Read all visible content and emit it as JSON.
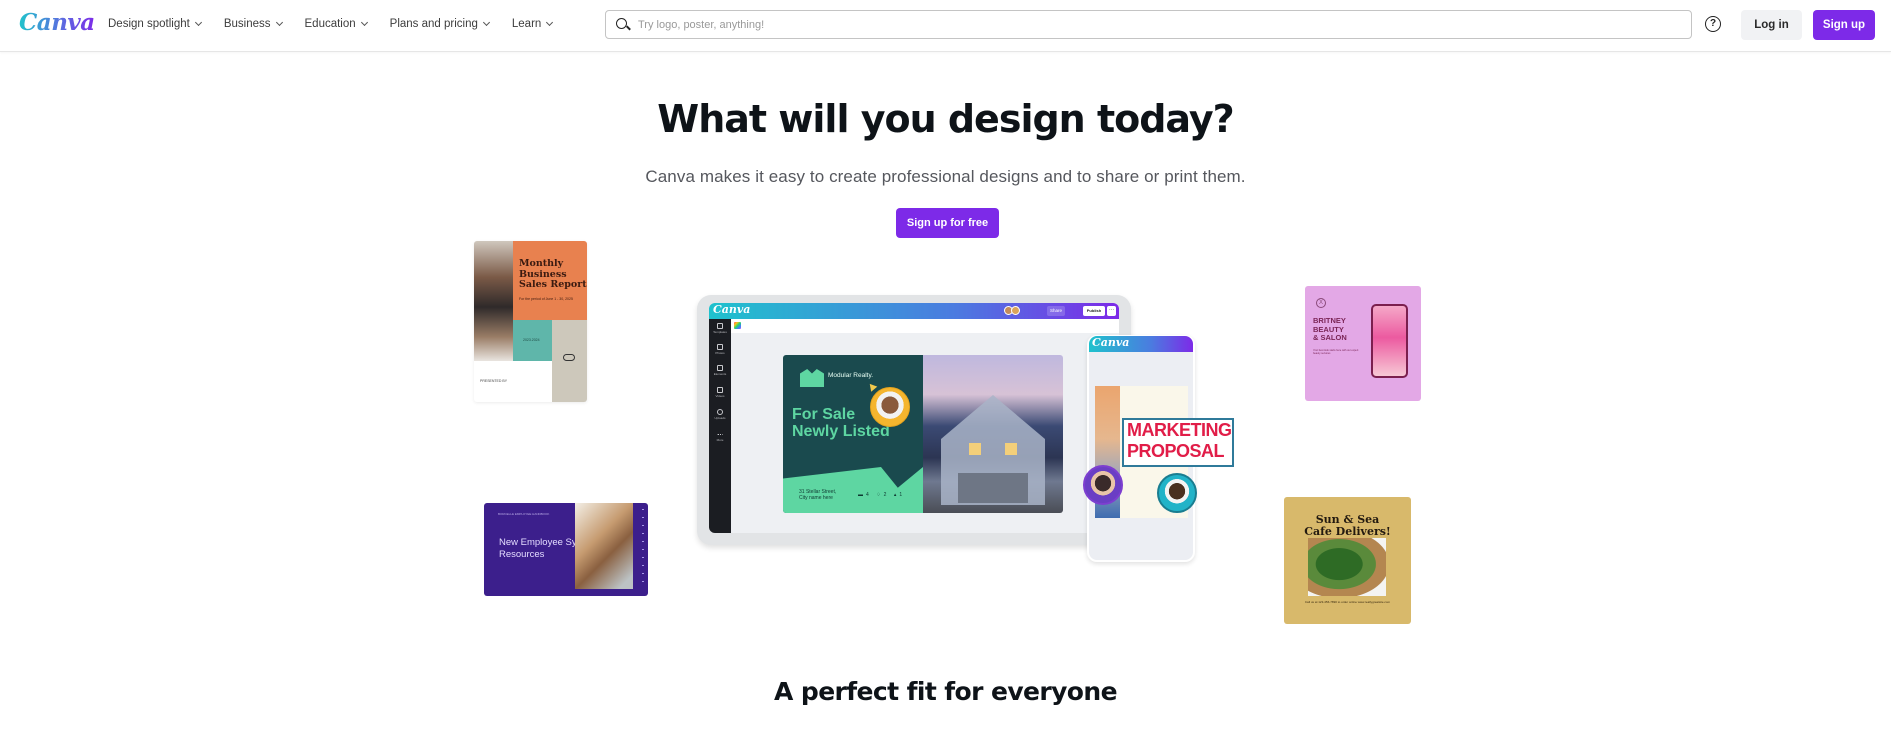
{
  "header": {
    "logo": "Canva",
    "nav": [
      {
        "label": "Design spotlight"
      },
      {
        "label": "Business"
      },
      {
        "label": "Education"
      },
      {
        "label": "Plans and pricing"
      },
      {
        "label": "Learn"
      }
    ],
    "search": {
      "placeholder": "Try logo, poster, anything!",
      "value": ""
    },
    "help_icon": "?",
    "login_label": "Log in",
    "signup_label": "Sign up"
  },
  "hero": {
    "title": "What will you design today?",
    "subtitle": "Canva makes it easy to create professional designs and to share or print them.",
    "cta_label": "Sign up for free"
  },
  "templates": {
    "sales_report": {
      "title": "Monthly Business Sales Report",
      "subtitle": "For the period of June 1 - 30, 2025",
      "date": "2023.2024",
      "footer": "PRESENTED BY"
    },
    "employee": {
      "small": "BORCELLE EMPLOYEE HANDBOOK",
      "title": "New Employee System and Resources"
    },
    "editor": {
      "logo": "Canva",
      "share_label": "Share",
      "publish_label": "Publish",
      "more_label": "···",
      "sidebar": [
        "Templates",
        "Photos",
        "Elements",
        "Videos",
        "Uploads",
        "More"
      ],
      "realty": {
        "brand": "Modular Realty.",
        "headline_line1": "For Sale",
        "headline_line2": "Newly Listed",
        "address_line1": "31 Stellar Street,",
        "address_line2": "City name here",
        "specs": "▬4 ♢2 ▴1"
      }
    },
    "phone": {
      "logo": "Canva",
      "proposal_line1": "MARKETING",
      "proposal_line2": "PROPOSAL"
    },
    "britney": {
      "logo_letter": "X",
      "title_line1": "BRITNEY",
      "title_line2": "BEAUTY",
      "title_line3": "& SALON",
      "small": "Your best look starts here with our expert beauty services"
    },
    "cafe": {
      "title_line1": "Sun & Sea",
      "title_line2": "Cafe Delivers!",
      "small": "Call us at 123-456-7890 to order online www.reallygreatsite.com"
    }
  },
  "section": {
    "title": "A perfect fit for everyone"
  },
  "colors": {
    "brand_purple": "#7d2ae8",
    "brand_teal": "#20c4cb"
  }
}
